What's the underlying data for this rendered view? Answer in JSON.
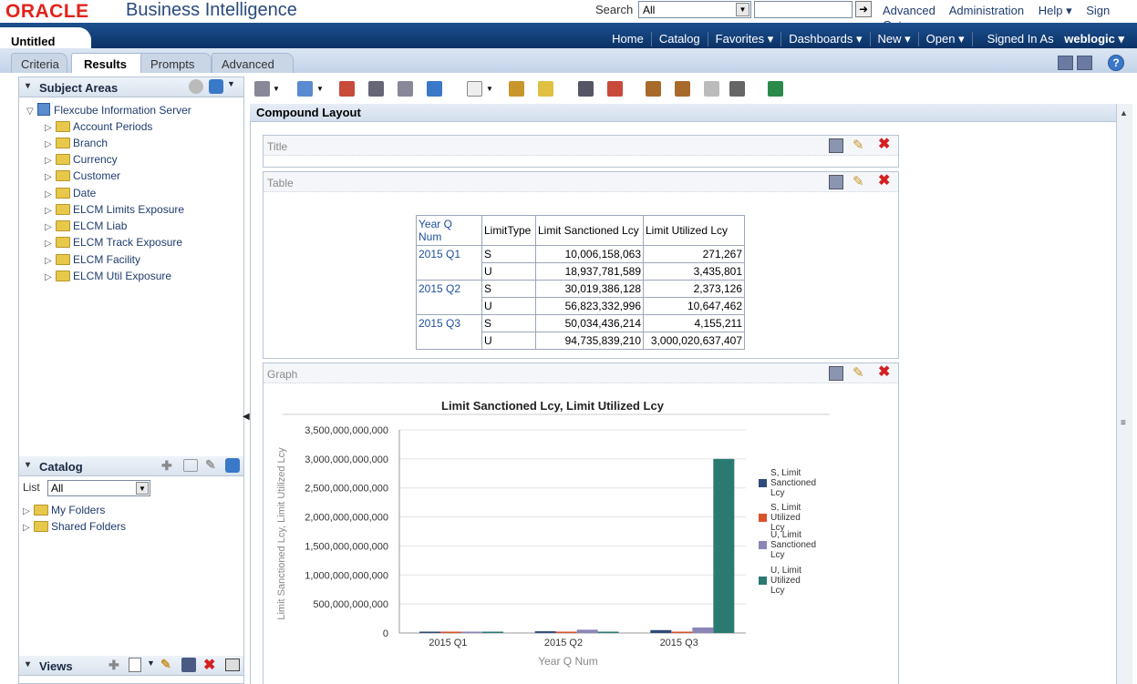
{
  "header": {
    "logo": "ORACLE",
    "product": "Business Intelligence",
    "search_label": "Search",
    "search_scope": "All",
    "links": [
      "Advanced",
      "Administration",
      "Help ▾",
      "Sign Out"
    ]
  },
  "navbar": {
    "doc_title": "Untitled",
    "links": [
      "Home",
      "Catalog",
      "Favorites ▾",
      "Dashboards ▾",
      "New ▾",
      "Open ▾",
      "Signed In As"
    ],
    "user": "weblogic ▾"
  },
  "tabs": [
    "Criteria",
    "Results",
    "Prompts",
    "Advanced"
  ],
  "subject_areas": {
    "title": "Subject Areas",
    "root": "Flexcube Information Server",
    "folders": [
      "Account Periods",
      "Branch",
      "Currency",
      "Customer",
      "Date",
      "ELCM Limits Exposure",
      "ELCM Liab",
      "ELCM Track Exposure",
      "ELCM Facility",
      "ELCM Util Exposure"
    ]
  },
  "catalog": {
    "title": "Catalog",
    "list_label": "List",
    "list_value": "All",
    "folders": [
      "My Folders",
      "Shared Folders"
    ]
  },
  "views_title": "Views",
  "main": {
    "layout_title": "Compound Layout",
    "views": [
      "Title",
      "Table",
      "Graph"
    ]
  },
  "table": {
    "headers": [
      "Year Q\nNum",
      "LimitType",
      "Limit Sanctioned Lcy",
      "Limit Utilized Lcy"
    ],
    "rows": [
      [
        "2015 Q1",
        "S",
        "10,006,158,063",
        "271,267"
      ],
      [
        "",
        "U",
        "18,937,781,589",
        "3,435,801"
      ],
      [
        "2015 Q2",
        "S",
        "30,019,386,128",
        "2,373,126"
      ],
      [
        "",
        "U",
        "56,823,332,996",
        "10,647,462"
      ],
      [
        "2015 Q3",
        "S",
        "50,034,436,214",
        "4,155,211"
      ],
      [
        "",
        "U",
        "94,735,839,210",
        "3,000,020,637,407"
      ]
    ]
  },
  "chart_data": {
    "type": "bar",
    "title": "Limit Sanctioned Lcy, Limit Utilized Lcy",
    "xlabel": "Year Q Num",
    "ylabel": "Limit Sanctioned Lcy, Limit Utilized Lcy",
    "categories": [
      "2015 Q1",
      "2015 Q2",
      "2015 Q3"
    ],
    "ylim": [
      0,
      3500000000000
    ],
    "yticks": [
      "0",
      "500,000,000,000",
      "1,000,000,000,000",
      "1,500,000,000,000",
      "2,000,000,000,000",
      "2,500,000,000,000",
      "3,000,000,000,000",
      "3,500,000,000,000"
    ],
    "legend_position": "right",
    "series": [
      {
        "name": "S, Limit Sanctioned Lcy",
        "color": "#2e4a78",
        "values": [
          10006158063,
          30019386128,
          50034436214
        ]
      },
      {
        "name": "S, Limit Utilized Lcy",
        "color": "#d9522a",
        "values": [
          271267,
          2373126,
          4155211
        ]
      },
      {
        "name": "U, Limit Sanctioned Lcy",
        "color": "#8a86b8",
        "values": [
          18937781589,
          56823332996,
          94735839210
        ]
      },
      {
        "name": "U, Limit Utilized Lcy",
        "color": "#2a7a72",
        "values": [
          3435801,
          10647462,
          3000020637407
        ]
      }
    ]
  }
}
